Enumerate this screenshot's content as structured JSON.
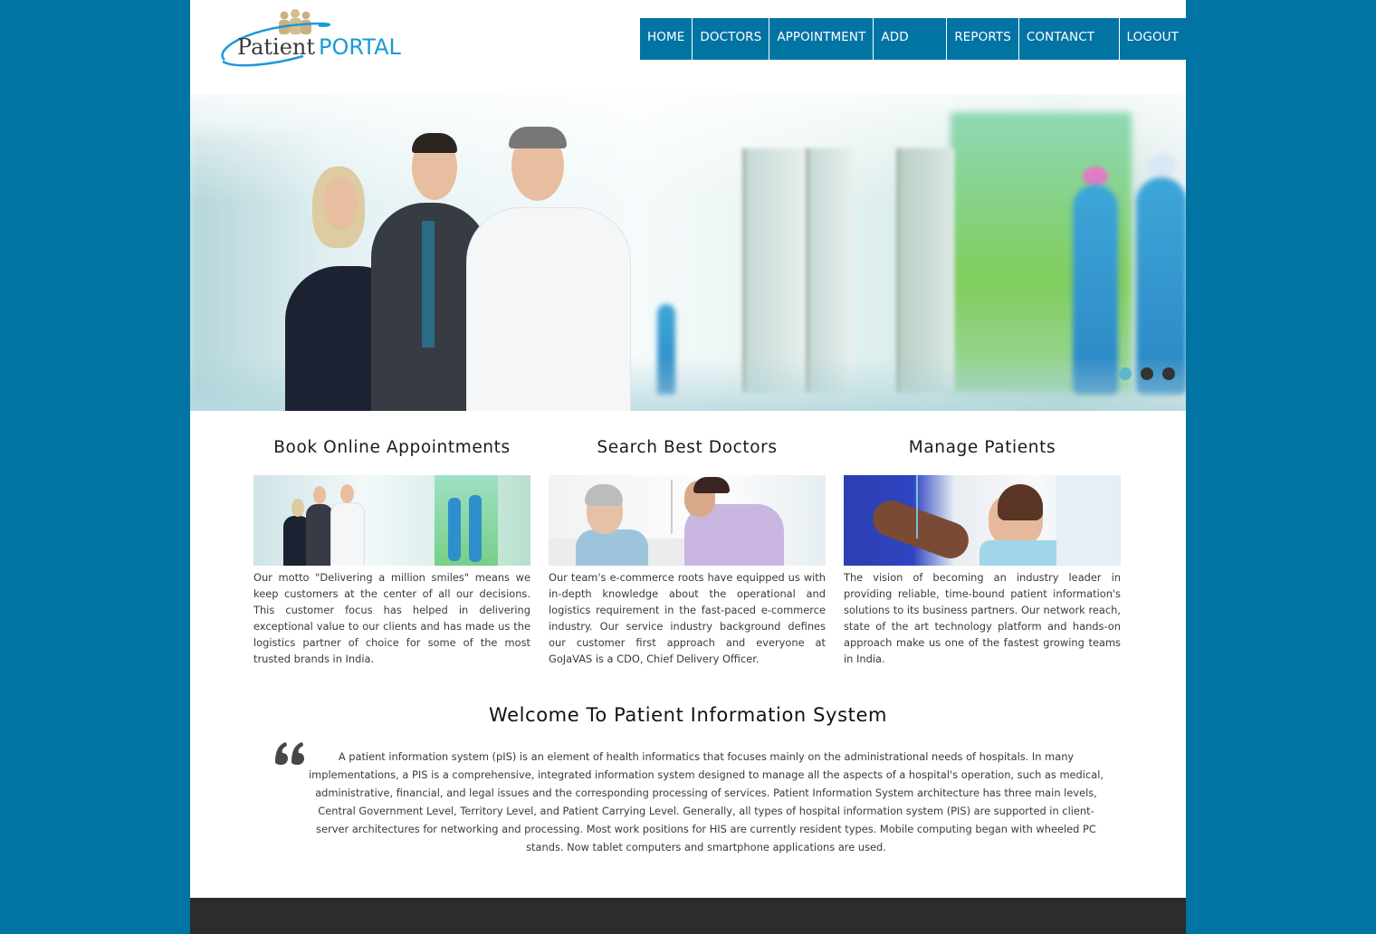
{
  "brand": {
    "logo_part1": "Patient",
    "logo_part2": "PORTAL",
    "colors": {
      "primary": "#0274a3",
      "logo_blue": "#1a9ad6",
      "logo_dark": "#3a3a3a",
      "logo_gold": "#c9b184",
      "footer": "#2c2c2c",
      "dot_active": "#5bb8cf"
    }
  },
  "nav": {
    "items": [
      {
        "label": "HOME"
      },
      {
        "label": "DOCTORS"
      },
      {
        "label": "APPOINTMENT"
      },
      {
        "label": "ADD NEW"
      },
      {
        "label": "REPORTS"
      },
      {
        "label": "CONTANCT US"
      },
      {
        "label": "LOGOUT"
      }
    ]
  },
  "slider": {
    "image": "doctors-team-in-hospital-corridor",
    "slide_count": 3,
    "active_slide": 1
  },
  "features": [
    {
      "title": "Book Online Appointments",
      "image": "doctors-team",
      "text": "Our motto \"Delivering a million smiles\" means we keep customers at the center of all our decisions. This customer focus has helped in delivering exceptional value to our clients and has made us the logistics partner of choice for some of the most trusted brands in India."
    },
    {
      "title": "Search Best Doctors",
      "image": "nurse-with-patient",
      "text": "Our team's e-commerce roots have equipped us with in-depth knowledge about the operational and logistics requirement in the fast-paced e-commerce industry. Our service industry background defines our customer first approach and everyone at GoJaVAS is a CDO, Chief Delivery Officer."
    },
    {
      "title": "Manage Patients",
      "image": "child-patient-care",
      "text": "The vision of becoming an industry leader in providing reliable, time-bound patient information's solutions to its business partners. Our network reach, state of the art technology platform and hands-on approach make us one of the fastest growing teams in India."
    }
  ],
  "welcome": {
    "title": "Welcome To Patient Information System",
    "quote_icon": "quote-icon",
    "text": "A patient information system (pIS) is an element of health informatics that focuses mainly on the administrational needs of hospitals. In many implementations, a PIS is a comprehensive, integrated information system designed to manage all the aspects of a hospital's operation, such as medical, administrative, financial, and legal issues and the corresponding processing of services. Patient Information System architecture has three main levels, Central Government Level, Territory Level, and Patient Carrying Level. Generally, all types of hospital information system (PIS) are supported in client-server architectures for networking and processing. Most work positions for HIS are currently resident types. Mobile computing began with wheeled PC stands. Now tablet computers and smartphone applications are used."
  }
}
